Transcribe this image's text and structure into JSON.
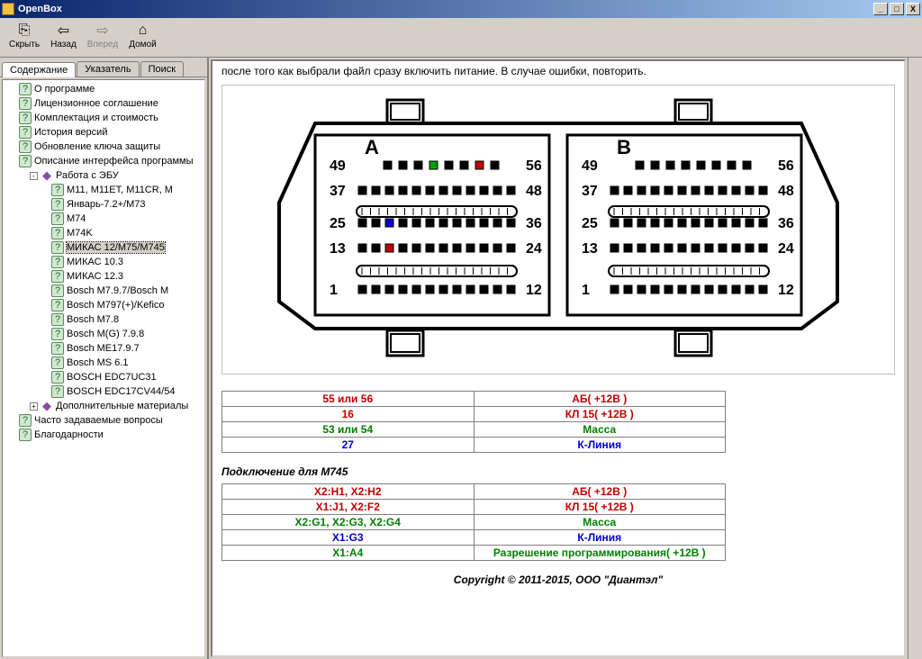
{
  "title": "OpenBox",
  "toolbar": {
    "hide": "Скрыть",
    "back": "Назад",
    "forward": "Вперед",
    "home": "Домой"
  },
  "tabs": {
    "contents": "Содержание",
    "index": "Указатель",
    "search": "Поиск"
  },
  "tree": [
    {
      "lvl": "l1",
      "icon": "q",
      "label": "О программе"
    },
    {
      "lvl": "l1",
      "icon": "q",
      "label": "Лицензионное соглашение"
    },
    {
      "lvl": "l1",
      "icon": "q",
      "label": "Комплектация и стоимость"
    },
    {
      "lvl": "l1",
      "icon": "q",
      "label": "История версий"
    },
    {
      "lvl": "l1",
      "icon": "q",
      "label": "Обновление ключа защиты"
    },
    {
      "lvl": "l1",
      "icon": "q",
      "label": "Описание интерфейса программы"
    },
    {
      "lvl": "l1b",
      "icon": "book",
      "label": "Работа с ЭБУ",
      "exp": "-"
    },
    {
      "lvl": "l2",
      "icon": "q",
      "label": "M11, M11ET, M11CR, M"
    },
    {
      "lvl": "l2",
      "icon": "q",
      "label": "Январь-7.2+/M73"
    },
    {
      "lvl": "l2",
      "icon": "q",
      "label": "M74"
    },
    {
      "lvl": "l2",
      "icon": "q",
      "label": "M74K"
    },
    {
      "lvl": "l2",
      "icon": "q",
      "label": "МИКАС 12/M75/M745",
      "sel": true
    },
    {
      "lvl": "l2",
      "icon": "q",
      "label": "МИКАС 10.3"
    },
    {
      "lvl": "l2",
      "icon": "q",
      "label": "МИКАС 12.3"
    },
    {
      "lvl": "l2",
      "icon": "q",
      "label": "Bosch M7.9.7/Bosch M"
    },
    {
      "lvl": "l2",
      "icon": "q",
      "label": "Bosch M797(+)/Kefico"
    },
    {
      "lvl": "l2",
      "icon": "q",
      "label": "Bosch M7.8"
    },
    {
      "lvl": "l2",
      "icon": "q",
      "label": "Bosch M(G) 7.9.8"
    },
    {
      "lvl": "l2",
      "icon": "q",
      "label": "Bosch ME17.9.7"
    },
    {
      "lvl": "l2",
      "icon": "q",
      "label": "Bosch MS 6.1"
    },
    {
      "lvl": "l2",
      "icon": "q",
      "label": "BOSCH EDC7UC31"
    },
    {
      "lvl": "l2",
      "icon": "q",
      "label": "BOSCH EDC17CV44/54"
    },
    {
      "lvl": "l1b",
      "icon": "book",
      "label": "Дополнительные материалы",
      "exp": "+"
    },
    {
      "lvl": "l1",
      "icon": "q",
      "label": "Часто задаваемые вопросы"
    },
    {
      "lvl": "l1",
      "icon": "q",
      "label": "Благодарности"
    }
  ],
  "content_text": "после того как выбрали файл сразу включить питание. В случае ошибки, повторить.",
  "connector": {
    "a_label": "A",
    "b_label": "B",
    "row_labels": [
      "49",
      "56",
      "37",
      "48",
      "25",
      "36",
      "13",
      "24",
      "1",
      "12"
    ]
  },
  "table1": [
    {
      "c": "red",
      "l": "55 или 56",
      "r": "АБ( +12В )"
    },
    {
      "c": "red",
      "l": "16",
      "r": "КЛ 15( +12В )"
    },
    {
      "c": "green",
      "l": "53 или 54",
      "r": "Масса"
    },
    {
      "c": "blue",
      "l": "27",
      "r": "К-Линия"
    }
  ],
  "section2_title": "Подключение для M745",
  "table2": [
    {
      "c": "red",
      "l": "X2:H1, X2:H2",
      "r": "АБ( +12В )"
    },
    {
      "c": "red",
      "l": "X1:J1, X2:F2",
      "r": "КЛ 15( +12В )"
    },
    {
      "c": "green",
      "l": "X2:G1, X2:G3, X2:G4",
      "r": "Масса"
    },
    {
      "c": "blue",
      "l": "X1:G3",
      "r": "К-Линия"
    },
    {
      "c": "green",
      "l": "X1:A4",
      "r": "Разрешение программирования( +12В )"
    }
  ],
  "copyright": "Copyright © 2011-2015, ООО \"Диантэл\""
}
